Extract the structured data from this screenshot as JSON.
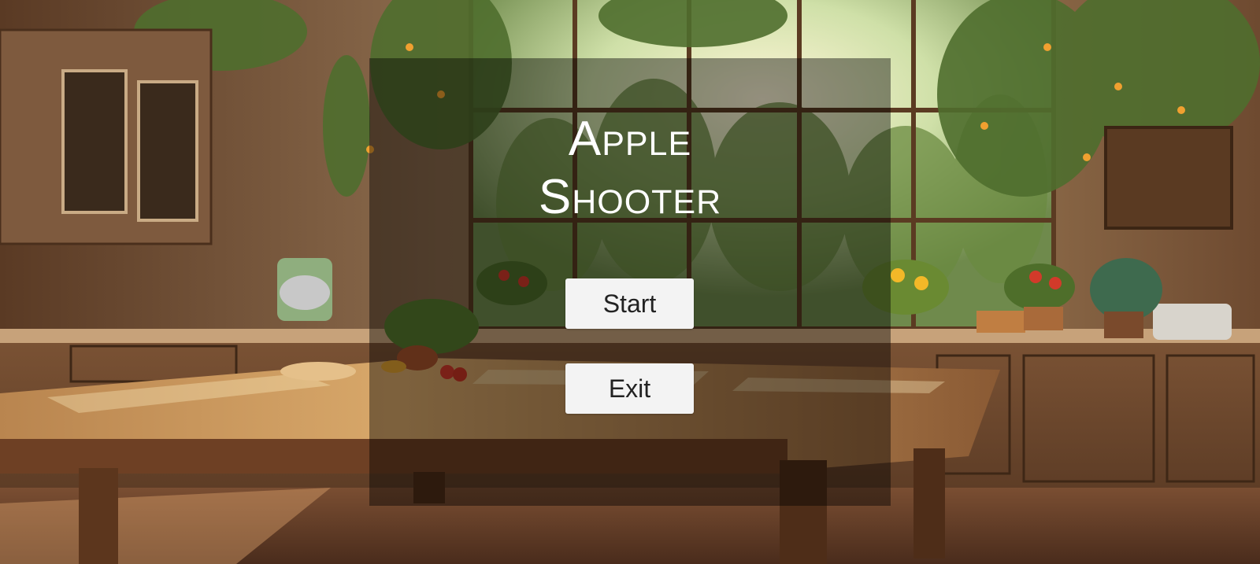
{
  "game": {
    "title_line1": "Apple",
    "title_line2": "Shooter"
  },
  "menu": {
    "start_label": "Start",
    "exit_label": "Exit"
  },
  "colors": {
    "panel_overlay": "rgba(0,0,0,0.42)",
    "button_bg": "#f3f3f3",
    "button_text": "#222222",
    "title_text": "#ffffff"
  },
  "background": {
    "description_icon": "kitchen-scene-illustration"
  }
}
